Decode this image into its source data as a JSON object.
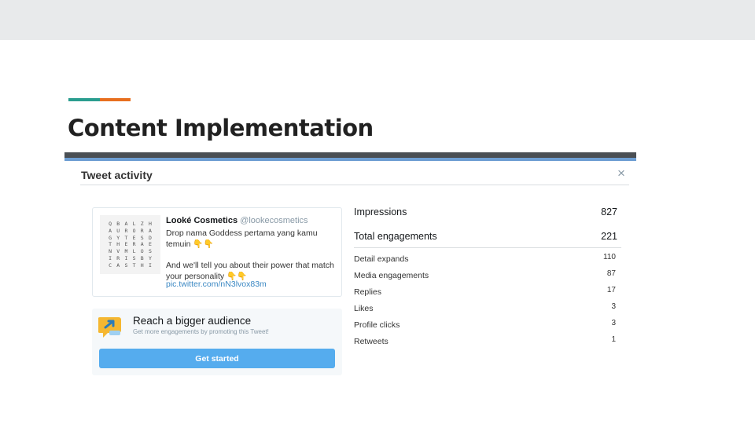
{
  "slide": {
    "title": "Content Implementation",
    "accent_colors": [
      "#2a9d8f",
      "#e76f1f"
    ]
  },
  "modal": {
    "title": "Tweet activity",
    "close_label": "×"
  },
  "tweet": {
    "author_name": "Looké Cosmetics",
    "author_handle": "@lookecosmetics",
    "line1": "Drop nama Goddess pertama yang kamu temuin 👇👇",
    "line2": "And we'll tell you about their power that match your personality 👇👇",
    "link": "pic.twitter.com/nN3lvox83m",
    "thumbnail_rows": [
      [
        "Q",
        "B",
        "A",
        "L",
        "Z",
        "H"
      ],
      [
        "A",
        "U",
        "R",
        "O",
        "R",
        "A"
      ],
      [
        "G",
        "Y",
        "T",
        "E",
        "S",
        "D"
      ],
      [
        "T",
        "H",
        "E",
        "R",
        "A",
        "E"
      ],
      [
        "N",
        "V",
        "M",
        "L",
        "O",
        "S"
      ],
      [
        "I",
        "R",
        "I",
        "S",
        "B",
        "Y"
      ],
      [
        "C",
        "A",
        "S",
        "T",
        "H",
        "I"
      ]
    ]
  },
  "promo": {
    "title": "Reach a bigger audience",
    "subtitle": "Get more engagements by promoting this Tweet!",
    "button_label": "Get started",
    "button_color": "#55acee"
  },
  "stats": {
    "main": [
      {
        "label": "Impressions",
        "value": "827"
      },
      {
        "label": "Total engagements",
        "value": "221"
      }
    ],
    "details": [
      {
        "label": "Detail expands",
        "value": "110"
      },
      {
        "label": "Media engagements",
        "value": "87"
      },
      {
        "label": "Replies",
        "value": "17"
      },
      {
        "label": "Likes",
        "value": "3"
      },
      {
        "label": "Profile clicks",
        "value": "3"
      },
      {
        "label": "Retweets",
        "value": "1"
      }
    ]
  }
}
